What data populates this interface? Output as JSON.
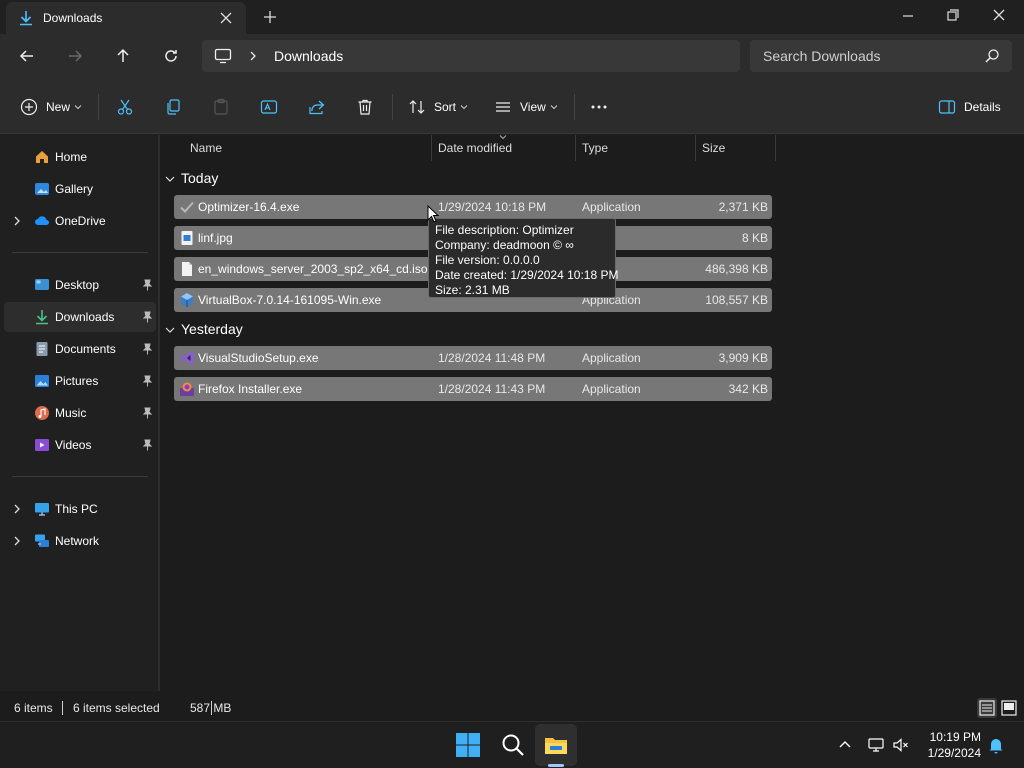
{
  "tab": {
    "title": "Downloads"
  },
  "address": {
    "crumb": "Downloads"
  },
  "search": {
    "placeholder": "Search Downloads"
  },
  "commands": {
    "new_label": "New",
    "sort_label": "Sort",
    "view_label": "View",
    "details_label": "Details"
  },
  "sidebar": {
    "items": [
      {
        "label": "Home",
        "icon": "home-icon"
      },
      {
        "label": "Gallery",
        "icon": "gallery-icon"
      },
      {
        "label": "OneDrive",
        "icon": "onedrive-icon"
      },
      {
        "label": "Desktop",
        "icon": "desktop-icon"
      },
      {
        "label": "Downloads",
        "icon": "downloads-icon"
      },
      {
        "label": "Documents",
        "icon": "documents-icon"
      },
      {
        "label": "Pictures",
        "icon": "pictures-icon"
      },
      {
        "label": "Music",
        "icon": "music-icon"
      },
      {
        "label": "Videos",
        "icon": "videos-icon"
      },
      {
        "label": "This PC",
        "icon": "this-pc-icon"
      },
      {
        "label": "Network",
        "icon": "network-icon"
      }
    ]
  },
  "columns": {
    "name": "Name",
    "date": "Date modified",
    "type": "Type",
    "size": "Size"
  },
  "groups": {
    "today": "Today",
    "yesterday": "Yesterday"
  },
  "files": [
    {
      "name": "Optimizer-16.4.exe",
      "date": "1/29/2024 10:18 PM",
      "type": "Application",
      "size": "2,371 KB"
    },
    {
      "name": "linf.jpg",
      "date": "",
      "type": "e",
      "size": "8 KB"
    },
    {
      "name": "en_windows_server_2003_sp2_x64_cd.iso",
      "date": "",
      "type": "so",
      "size": "486,398 KB"
    },
    {
      "name": "VirtualBox-7.0.14-161095-Win.exe",
      "date": "",
      "type": "Application",
      "size": "108,557 KB"
    },
    {
      "name": "VisualStudioSetup.exe",
      "date": "1/28/2024 11:48 PM",
      "type": "Application",
      "size": "3,909 KB"
    },
    {
      "name": "Firefox Installer.exe",
      "date": "1/28/2024 11:43 PM",
      "type": "Application",
      "size": "342 KB"
    }
  ],
  "tooltip": {
    "line1": "File description: Optimizer",
    "line2": "Company: deadmoon © ∞",
    "line3": "File version: 0.0.0.0",
    "line4": "Date created: 1/29/2024 10:18 PM",
    "line5": "Size: 2.31 MB"
  },
  "status": {
    "items": "6 items",
    "selected": "6 items selected",
    "size": "587 MB"
  },
  "clock": {
    "time": "10:19 PM",
    "date": "1/29/2024"
  },
  "colors": {
    "accent": "#4cc2ff",
    "selection": "#777777",
    "folder": "#f5c243"
  }
}
